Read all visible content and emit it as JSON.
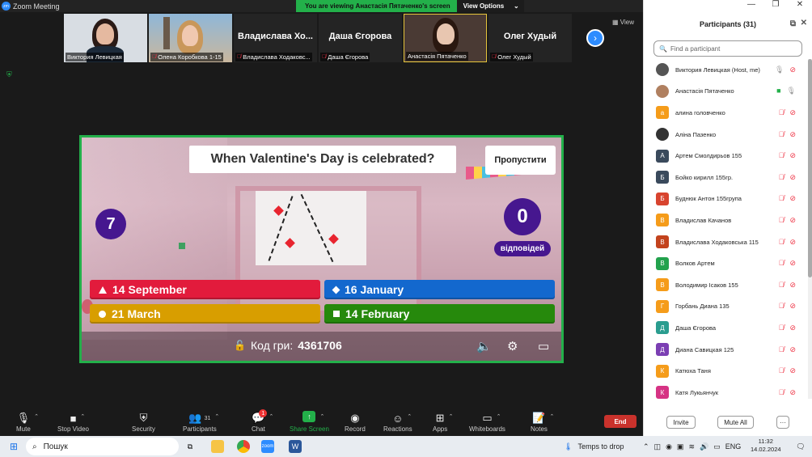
{
  "window": {
    "title": "Zoom Meeting",
    "viewing_text": "You are viewing Анастасія Пятаченко's screen",
    "view_options": "View Options"
  },
  "thumbnails": [
    {
      "name": "Виктория Левицкая",
      "muted": false,
      "video": true
    },
    {
      "name": "Олена Коробкова 1-15",
      "muted": true,
      "video": true
    },
    {
      "name": "Владислава Ходаковс...",
      "big": "Владислава  Хо...",
      "muted": true,
      "video": false
    },
    {
      "name": "Даша Єгорова",
      "big": "Даша Єгорова",
      "muted": true,
      "video": false
    },
    {
      "name": "Анастасія Пятаченко",
      "muted": false,
      "video": true,
      "active": true
    },
    {
      "name": "Олег Худый",
      "big": "Олег Худый",
      "muted": true,
      "video": false
    }
  ],
  "view_label": "View",
  "quiz": {
    "question": "When Valentine's Day is celebrated?",
    "skip": "Пропустити",
    "timer": "7",
    "answers_count": "0",
    "answers_label": "відповідей",
    "answers": [
      "14 September",
      "16 January",
      "21 March",
      "14 February"
    ],
    "pin_label": "Код гри:",
    "pin_value": "4361706"
  },
  "toolbar": {
    "mute": "Mute",
    "stop_video": "Stop Video",
    "security": "Security",
    "participants": "Participants",
    "participants_count": "31",
    "chat": "Chat",
    "chat_badge": "1",
    "share_screen": "Share Screen",
    "record": "Record",
    "reactions": "Reactions",
    "apps": "Apps",
    "whiteboards": "Whiteboards",
    "notes": "Notes",
    "end": "End"
  },
  "panel": {
    "title": "Participants (31)",
    "search_placeholder": "Find a participant",
    "invite": "Invite",
    "mute_all": "Mute All",
    "more": "···",
    "participants": [
      {
        "name": "Виктория Левицкая (Host, me)",
        "avatar": "",
        "color": "#555",
        "photo": true,
        "muted": false,
        "video_on": false,
        "host": true
      },
      {
        "name": "Анастасія Пятаченко",
        "avatar": "",
        "color": "#b08060",
        "photo": true,
        "muted": false,
        "video_on": true
      },
      {
        "name": "алина головченко",
        "avatar": "а",
        "color": "#f59c1a",
        "muted": true
      },
      {
        "name": "Аліна Пазенко",
        "avatar": "",
        "color": "#333",
        "photo": true,
        "muted": true
      },
      {
        "name": "Артем Смолдирьов 155",
        "avatar": "А",
        "color": "#3a4a5c",
        "muted": true
      },
      {
        "name": "Бойко кирилл 155гр.",
        "avatar": "Б",
        "color": "#3a4a5c",
        "muted": true
      },
      {
        "name": "Буднюк Антон 155група",
        "avatar": "Б",
        "color": "#d8442f",
        "muted": true
      },
      {
        "name": "Владислав Качанов",
        "avatar": "В",
        "color": "#f59c1a",
        "muted": true
      },
      {
        "name": "Владислава Ходаковська 115",
        "avatar": "В",
        "color": "#c3431d",
        "muted": true
      },
      {
        "name": "Волков Артем",
        "avatar": "В",
        "color": "#23a24d",
        "muted": true
      },
      {
        "name": "Володимир Ісаков 155",
        "avatar": "В",
        "color": "#f59c1a",
        "muted": true
      },
      {
        "name": "Горбань Диана 135",
        "avatar": "Г",
        "color": "#f59c1a",
        "muted": true
      },
      {
        "name": "Даша Єгорова",
        "avatar": "Д",
        "color": "#2a9d8f",
        "muted": true
      },
      {
        "name": "Диана Савицкая 125",
        "avatar": "Д",
        "color": "#7b3fb3",
        "muted": true
      },
      {
        "name": "Катюха Таня",
        "avatar": "К",
        "color": "#f59c1a",
        "muted": true
      },
      {
        "name": "Катя Лукьянчук",
        "avatar": "К",
        "color": "#d63384",
        "muted": true
      }
    ]
  },
  "taskbar": {
    "search": "Пошук",
    "weather": "Temps to drop",
    "lang": "ENG",
    "time": "11:32",
    "date": "14.02.2024"
  }
}
